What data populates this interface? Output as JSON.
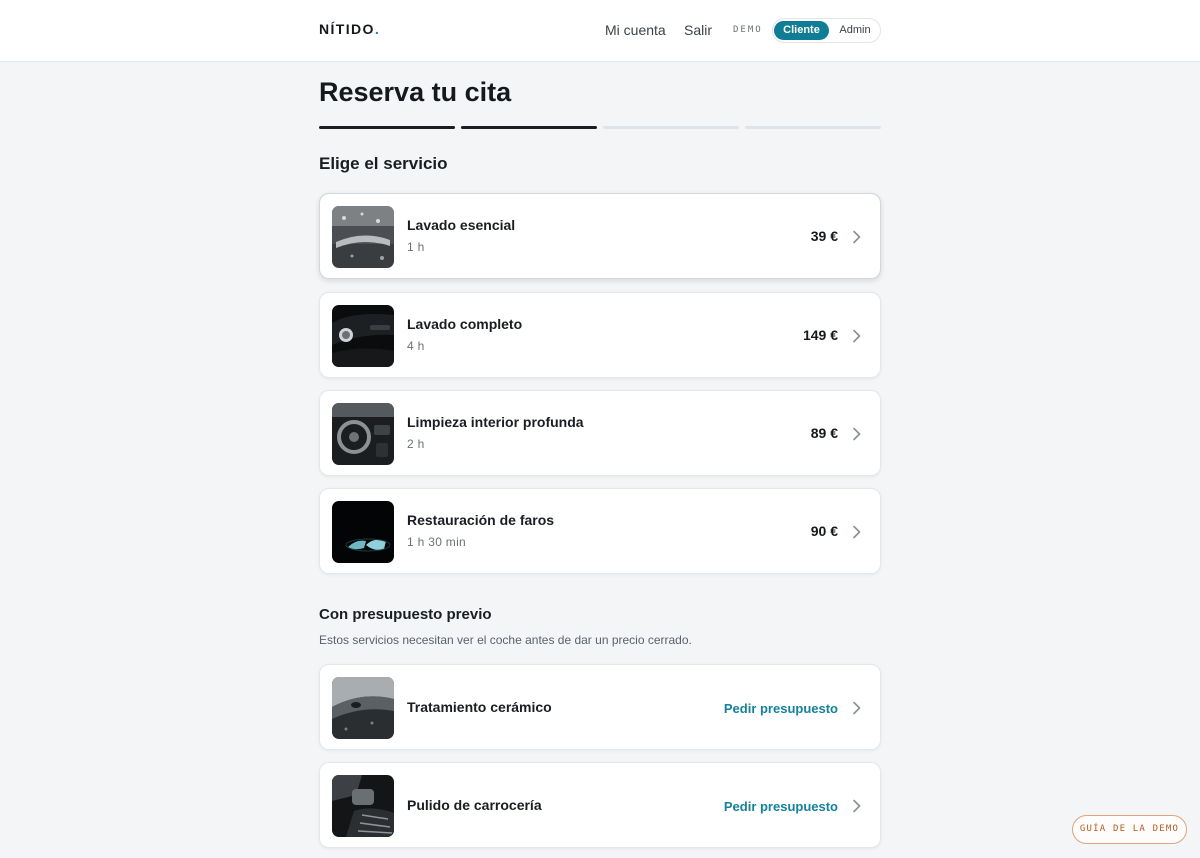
{
  "header": {
    "logo_text": "NÍTIDO",
    "logo_dot": ".",
    "account_link": "Mi cuenta",
    "logout_link": "Salir",
    "demo_label": "DEMO",
    "mode_client": "Cliente",
    "mode_admin": "Admin"
  },
  "page": {
    "title": "Reserva tu cita",
    "progress": {
      "current_step": 2,
      "total_steps": 4
    }
  },
  "services_section": {
    "title": "Elige el servicio",
    "items": [
      {
        "name": "Lavado esencial",
        "duration": "1 h",
        "price": "39 €"
      },
      {
        "name": "Lavado completo",
        "duration": "4 h",
        "price": "149 €"
      },
      {
        "name": "Limpieza interior profunda",
        "duration": "2 h",
        "price": "89 €"
      },
      {
        "name": "Restauración de faros",
        "duration": "1 h 30 min",
        "price": "90 €"
      }
    ]
  },
  "quote_section": {
    "title": "Con presupuesto previo",
    "description": "Estos servicios necesitan ver el coche antes de dar un precio cerrado.",
    "items": [
      {
        "name": "Tratamiento cerámico",
        "action": "Pedir presupuesto"
      },
      {
        "name": "Pulido de carrocería",
        "action": "Pedir presupuesto"
      }
    ]
  },
  "guide_button": "GUÍA DE LA DEMO",
  "colors": {
    "accent": "#0f7d96",
    "link": "#15819b",
    "guide": "#b35a22"
  }
}
